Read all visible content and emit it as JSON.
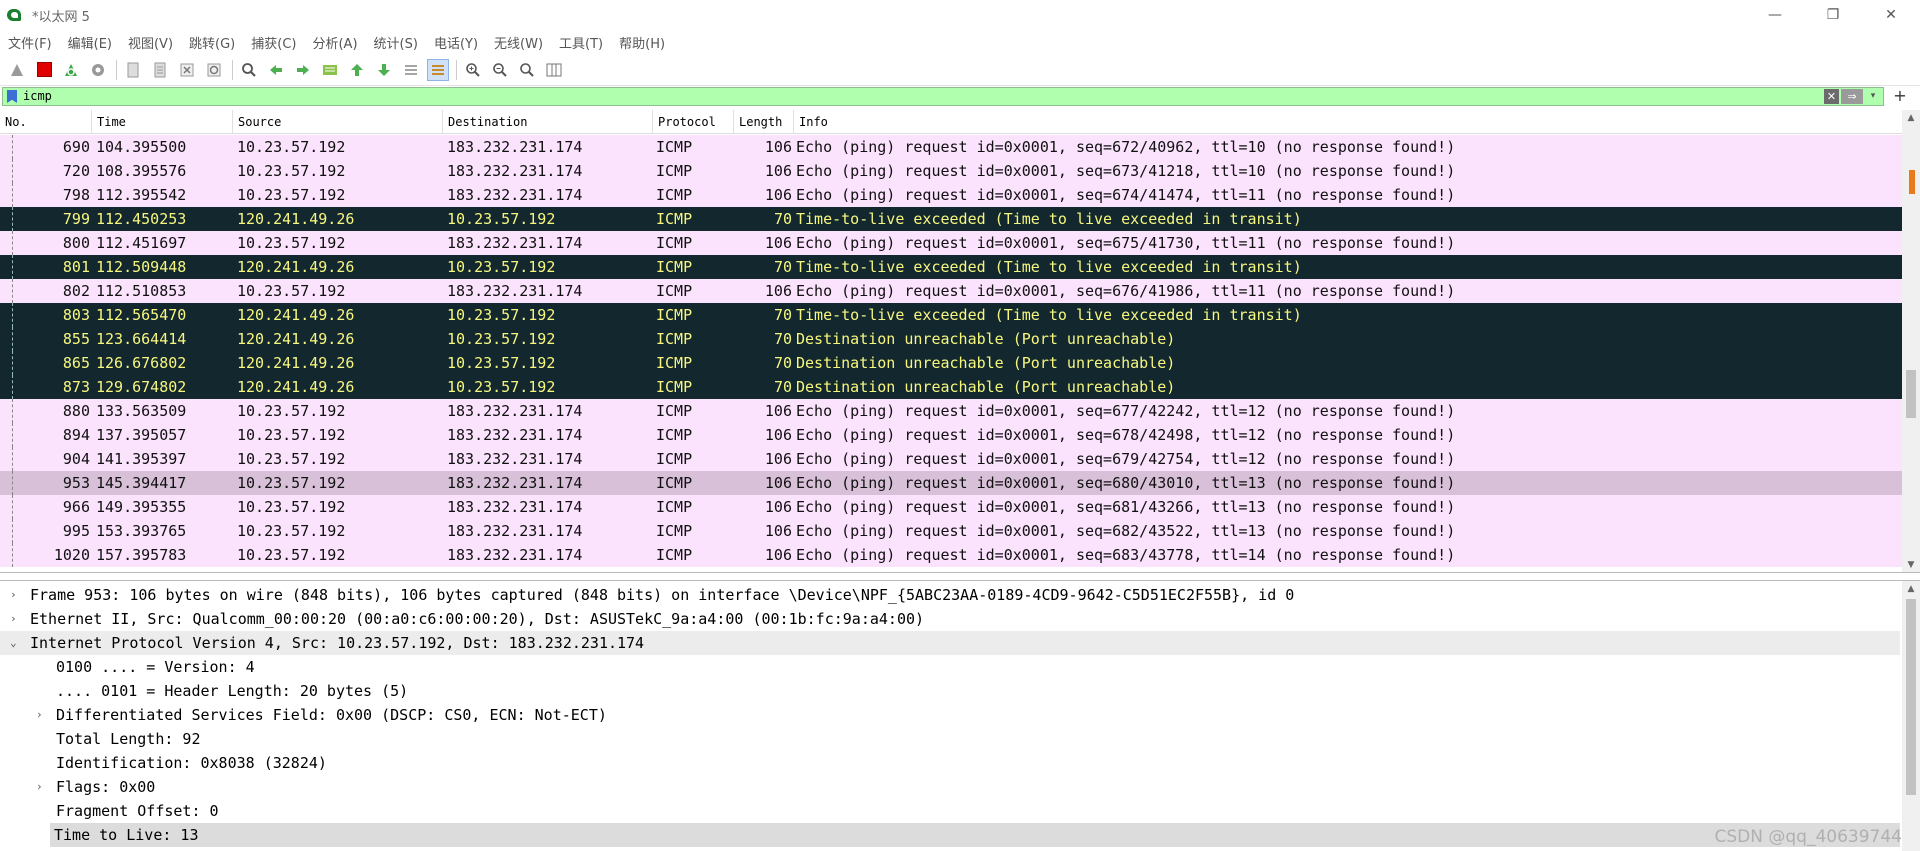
{
  "window": {
    "title": "*以太网 5",
    "minimize": "—",
    "maximize": "❐",
    "close": "✕"
  },
  "menu": [
    "文件(F)",
    "编辑(E)",
    "视图(V)",
    "跳转(G)",
    "捕获(C)",
    "分析(A)",
    "统计(S)",
    "电话(Y)",
    "无线(W)",
    "工具(T)",
    "帮助(H)"
  ],
  "filter": {
    "value": "icmp",
    "clear": "✕",
    "apply": "⇒",
    "dropdown": "▾",
    "add": "+"
  },
  "columns": [
    "No.",
    "Time",
    "Source",
    "Destination",
    "Protocol",
    "Length",
    "Info"
  ],
  "packets": [
    {
      "no": "690",
      "time": "104.395500",
      "src": "10.23.57.192",
      "dst": "183.232.231.174",
      "proto": "ICMP",
      "len": "106",
      "info": "Echo (ping) request  id=0x0001, seq=672/40962, ttl=10 (no response found!)",
      "kind": "echo"
    },
    {
      "no": "720",
      "time": "108.395576",
      "src": "10.23.57.192",
      "dst": "183.232.231.174",
      "proto": "ICMP",
      "len": "106",
      "info": "Echo (ping) request  id=0x0001, seq=673/41218, ttl=10 (no response found!)",
      "kind": "echo"
    },
    {
      "no": "798",
      "time": "112.395542",
      "src": "10.23.57.192",
      "dst": "183.232.231.174",
      "proto": "ICMP",
      "len": "106",
      "info": "Echo (ping) request  id=0x0001, seq=674/41474, ttl=11 (no response found!)",
      "kind": "echo"
    },
    {
      "no": "799",
      "time": "112.450253",
      "src": "120.241.49.26",
      "dst": "10.23.57.192",
      "proto": "ICMP",
      "len": "70",
      "info": "Time-to-live exceeded (Time to live exceeded in transit)",
      "kind": "err"
    },
    {
      "no": "800",
      "time": "112.451697",
      "src": "10.23.57.192",
      "dst": "183.232.231.174",
      "proto": "ICMP",
      "len": "106",
      "info": "Echo (ping) request  id=0x0001, seq=675/41730, ttl=11 (no response found!)",
      "kind": "echo"
    },
    {
      "no": "801",
      "time": "112.509448",
      "src": "120.241.49.26",
      "dst": "10.23.57.192",
      "proto": "ICMP",
      "len": "70",
      "info": "Time-to-live exceeded (Time to live exceeded in transit)",
      "kind": "err"
    },
    {
      "no": "802",
      "time": "112.510853",
      "src": "10.23.57.192",
      "dst": "183.232.231.174",
      "proto": "ICMP",
      "len": "106",
      "info": "Echo (ping) request  id=0x0001, seq=676/41986, ttl=11 (no response found!)",
      "kind": "echo"
    },
    {
      "no": "803",
      "time": "112.565470",
      "src": "120.241.49.26",
      "dst": "10.23.57.192",
      "proto": "ICMP",
      "len": "70",
      "info": "Time-to-live exceeded (Time to live exceeded in transit)",
      "kind": "err"
    },
    {
      "no": "855",
      "time": "123.664414",
      "src": "120.241.49.26",
      "dst": "10.23.57.192",
      "proto": "ICMP",
      "len": "70",
      "info": "Destination unreachable (Port unreachable)",
      "kind": "err"
    },
    {
      "no": "865",
      "time": "126.676802",
      "src": "120.241.49.26",
      "dst": "10.23.57.192",
      "proto": "ICMP",
      "len": "70",
      "info": "Destination unreachable (Port unreachable)",
      "kind": "err"
    },
    {
      "no": "873",
      "time": "129.674802",
      "src": "120.241.49.26",
      "dst": "10.23.57.192",
      "proto": "ICMP",
      "len": "70",
      "info": "Destination unreachable (Port unreachable)",
      "kind": "err"
    },
    {
      "no": "880",
      "time": "133.563509",
      "src": "10.23.57.192",
      "dst": "183.232.231.174",
      "proto": "ICMP",
      "len": "106",
      "info": "Echo (ping) request  id=0x0001, seq=677/42242, ttl=12 (no response found!)",
      "kind": "echo"
    },
    {
      "no": "894",
      "time": "137.395057",
      "src": "10.23.57.192",
      "dst": "183.232.231.174",
      "proto": "ICMP",
      "len": "106",
      "info": "Echo (ping) request  id=0x0001, seq=678/42498, ttl=12 (no response found!)",
      "kind": "echo"
    },
    {
      "no": "904",
      "time": "141.395397",
      "src": "10.23.57.192",
      "dst": "183.232.231.174",
      "proto": "ICMP",
      "len": "106",
      "info": "Echo (ping) request  id=0x0001, seq=679/42754, ttl=12 (no response found!)",
      "kind": "echo"
    },
    {
      "no": "953",
      "time": "145.394417",
      "src": "10.23.57.192",
      "dst": "183.232.231.174",
      "proto": "ICMP",
      "len": "106",
      "info": "Echo (ping) request  id=0x0001, seq=680/43010, ttl=13 (no response found!)",
      "kind": "sel"
    },
    {
      "no": "966",
      "time": "149.395355",
      "src": "10.23.57.192",
      "dst": "183.232.231.174",
      "proto": "ICMP",
      "len": "106",
      "info": "Echo (ping) request  id=0x0001, seq=681/43266, ttl=13 (no response found!)",
      "kind": "echo"
    },
    {
      "no": "995",
      "time": "153.393765",
      "src": "10.23.57.192",
      "dst": "183.232.231.174",
      "proto": "ICMP",
      "len": "106",
      "info": "Echo (ping) request  id=0x0001, seq=682/43522, ttl=13 (no response found!)",
      "kind": "echo"
    },
    {
      "no": "1020",
      "time": "157.395783",
      "src": "10.23.57.192",
      "dst": "183.232.231.174",
      "proto": "ICMP",
      "len": "106",
      "info": "Echo (ping) request  id=0x0001, seq=683/43778, ttl=14 (no response found!)",
      "kind": "echo"
    }
  ],
  "details": [
    {
      "text": "Frame 953: 106 bytes on wire (848 bits), 106 bytes captured (848 bits) on interface \\Device\\NPF_{5ABC23AA-0189-4CD9-9642-C5D51EC2F55B}, id 0",
      "arrow": "›",
      "level": 0,
      "style": ""
    },
    {
      "text": "Ethernet II, Src: Qualcomm_00:00:20 (00:a0:c6:00:00:20), Dst: ASUSTekC_9a:a4:00 (00:1b:fc:9a:a4:00)",
      "arrow": "›",
      "level": 0,
      "style": ""
    },
    {
      "text": "Internet Protocol Version 4, Src: 10.23.57.192, Dst: 183.232.231.174",
      "arrow": "⌄",
      "level": 0,
      "style": "hl"
    },
    {
      "text": "0100 .... = Version: 4",
      "arrow": "",
      "level": 1,
      "style": ""
    },
    {
      "text": ".... 0101 = Header Length: 20 bytes (5)",
      "arrow": "",
      "level": 1,
      "style": ""
    },
    {
      "text": "Differentiated Services Field: 0x00 (DSCP: CS0, ECN: Not-ECT)",
      "arrow": "›",
      "level": 1,
      "style": ""
    },
    {
      "text": "Total Length: 92",
      "arrow": "",
      "level": 1,
      "style": ""
    },
    {
      "text": "Identification: 0x8038 (32824)",
      "arrow": "",
      "level": 1,
      "style": ""
    },
    {
      "text": "Flags: 0x00",
      "arrow": "›",
      "level": 1,
      "style": ""
    },
    {
      "text": "Fragment Offset: 0",
      "arrow": "",
      "level": 1,
      "style": ""
    },
    {
      "text": "Time to Live: 13",
      "arrow": "",
      "level": 1,
      "style": "hl-sel"
    }
  ],
  "watermark": "CSDN @qq_40639744",
  "colors": {
    "echo_row": "#fbe2fd",
    "error_row": "#12272e",
    "error_text": "#f7f77f",
    "selected_row": "#d8c0d9",
    "filter_bg": "#afffaf"
  }
}
